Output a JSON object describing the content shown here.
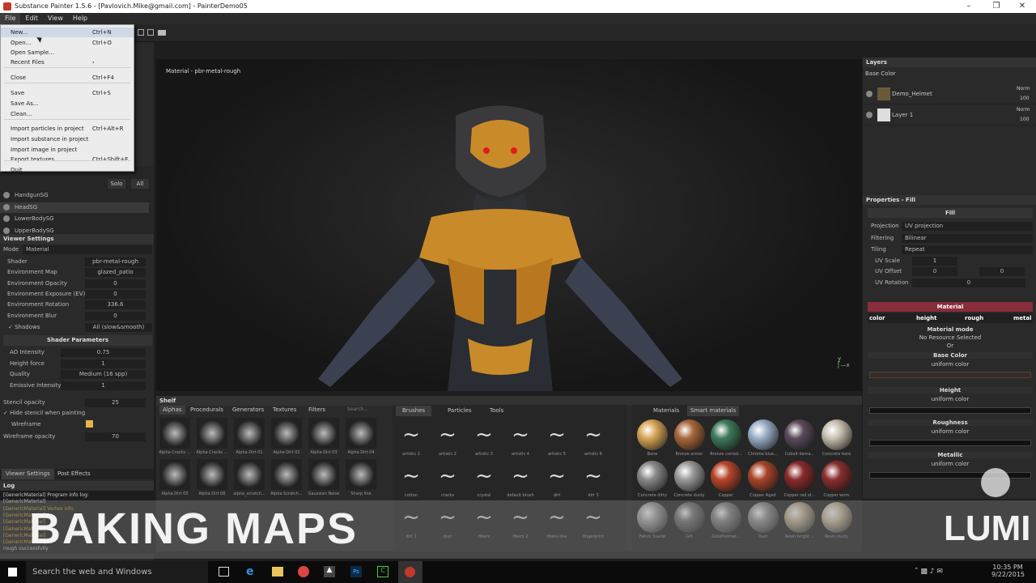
{
  "window": {
    "title": "Substance Painter 1.5.6 - [Pavlovich.Mike@gmail.com] - PainterDemo05"
  },
  "menubar": {
    "items": [
      "File",
      "Edit",
      "View",
      "Help"
    ]
  },
  "file_menu": {
    "items": [
      {
        "label": "New...",
        "shortcut": "Ctrl+N"
      },
      {
        "label": "Open...",
        "shortcut": "Ctrl+O"
      },
      {
        "label": "Open Sample...",
        "shortcut": ""
      },
      {
        "label": "Recent Files",
        "shortcut": "›"
      },
      {
        "label": "Close",
        "shortcut": "Ctrl+F4"
      },
      {
        "label": "Save",
        "shortcut": "Ctrl+S"
      },
      {
        "label": "Save As...",
        "shortcut": ""
      },
      {
        "label": "Clean...",
        "shortcut": ""
      },
      {
        "label": "Import particles in project",
        "shortcut": "Ctrl+Alt+R"
      },
      {
        "label": "Import substance in project",
        "shortcut": ""
      },
      {
        "label": "Import image in project",
        "shortcut": ""
      },
      {
        "label": "Export textures...",
        "shortcut": "Ctrl+Shift+E"
      },
      {
        "label": "Quit",
        "shortcut": ""
      }
    ]
  },
  "texture_sets": {
    "solo_label": "Solo",
    "all_label": "All",
    "items": [
      "HandgunSG",
      "HeadSG",
      "LowerBodySG",
      "UpperBodySG"
    ]
  },
  "viewer_settings": {
    "title": "Viewer Settings",
    "mode_label": "Mode",
    "mode_value": "Material",
    "rows": [
      {
        "label": "Shader",
        "value": "pbr-metal-rough"
      },
      {
        "label": "Environment Map",
        "value": "glazed_patio"
      },
      {
        "label": "Environment Opacity",
        "value": "0"
      },
      {
        "label": "Environment Exposure (EV)",
        "value": "0"
      },
      {
        "label": "Environment Rotation",
        "value": "336.6"
      },
      {
        "label": "Environment Blur",
        "value": "0"
      }
    ],
    "shadows_label": "Shadows",
    "shadows_value": "All (slow&smooth)",
    "shader_params_title": "Shader Parameters",
    "params": [
      {
        "label": "AO Intensity",
        "value": "0.75"
      },
      {
        "label": "Height force",
        "value": "1"
      },
      {
        "label": "Quality",
        "value": "Medium (16 spp)"
      },
      {
        "label": "Emissive Intensity",
        "value": "1"
      }
    ],
    "stencil_opacity_label": "Stencil opacity",
    "stencil_opacity_value": "25",
    "hide_stencil_label": "Hide stencil when painting",
    "wireframe_label": "Wireframe",
    "wireframe_opacity_label": "Wireframe opacity",
    "wireframe_opacity_value": "70",
    "tabs": [
      "Viewer Settings",
      "Post Effects"
    ]
  },
  "log": {
    "title": "Log",
    "lines": [
      "[GenericMaterial] Program info log:",
      "[GenericMaterial]",
      "[GenericMaterial] Vertex info",
      "[GenericMaterial]",
      "[GenericMaterial]",
      "[GenericMaterial]",
      "[GenericMaterial]",
      "[GenericMaterial]",
      "rough successfully"
    ]
  },
  "viewport": {
    "label": "Material - pbr-metal-rough"
  },
  "layers": {
    "title": "Layers",
    "channel": "Base Color",
    "items": [
      {
        "name": "Demo_Helmet",
        "blend": "Norm",
        "opacity": "100"
      },
      {
        "name": "Layer 1",
        "blend": "Norm",
        "opacity": "100"
      }
    ]
  },
  "properties": {
    "title": "Properties - Fill",
    "fill_title": "Fill",
    "rows": [
      {
        "label": "Projection",
        "value": "UV projection"
      },
      {
        "label": "Filtering",
        "value": "Bilinear"
      },
      {
        "label": "Tiling",
        "value": "Repeat"
      }
    ],
    "uv_scale_label": "UV Scale",
    "uv_scale_value": "1",
    "uv_offset_label": "UV Offset",
    "uv_offset_x": "0",
    "uv_offset_y": "0",
    "uv_rotation_label": "UV Rotation",
    "uv_rotation_value": "0",
    "material_title": "Material",
    "material_tabs": [
      "color",
      "height",
      "rough",
      "metal"
    ],
    "material_mode_label": "Material mode",
    "material_mode_value": "No Resource Selected",
    "or_label": "Or",
    "channels": [
      {
        "name": "Base Color",
        "sub": "uniform color"
      },
      {
        "name": "Height",
        "sub": "uniform color"
      },
      {
        "name": "Roughness",
        "sub": "uniform color"
      },
      {
        "name": "Metallic",
        "sub": "uniform color"
      }
    ]
  },
  "shelf": {
    "title": "Shelf",
    "tabs": [
      "Alphas",
      "Procedurals",
      "Generators",
      "Textures",
      "Filters"
    ],
    "search_placeholder": "Search...",
    "alpha_labels": [
      "Alpha Cracks ...",
      "Alpha Cracks ...",
      "Alpha Dirt 01",
      "Alpha Dirt 02",
      "Alpha Dirt 03",
      "Alpha Dirt 04",
      "Alpha Dirt 05",
      "Alpha Dirt 06",
      "alpha_scratch...",
      "Alpha Scratch...",
      "Gaussian Noise",
      "Sharp line"
    ],
    "brush_tabs": [
      "Brushes",
      "Particles",
      "Tools"
    ],
    "brush_labels": [
      "artistic 1",
      "artistic 2",
      "artistic 3",
      "artistic 4",
      "artistic 5",
      "artistic 6",
      "cotton",
      "cracks",
      "crystal",
      "default brush",
      "dirt",
      "dirt 3",
      "dirt 1",
      "dust",
      "fibers",
      "fibers 2",
      "fibers line",
      "fingerprint"
    ],
    "material_tabs": [
      "Materials",
      "Smart materials"
    ],
    "material_labels": [
      "Bone",
      "Bronze armor",
      "Bronze corrod...",
      "Chrome blue...",
      "Cobalt dama...",
      "Concrete bare",
      "Concrete dirty",
      "Concrete dusty",
      "Copper",
      "Copper Aged",
      "Copper red st...",
      "Copper worn",
      "Fabric Suede",
      "Gilt",
      "Gold/helmet...",
      "Dust",
      "Resin bright ...",
      "Resin dusty"
    ]
  },
  "overlay": {
    "title": "BAKING MAPS",
    "brand": "LUMI"
  },
  "taskbar": {
    "search": "Search the web and Windows",
    "time": "10:35 PM",
    "date": "9/22/2015"
  }
}
